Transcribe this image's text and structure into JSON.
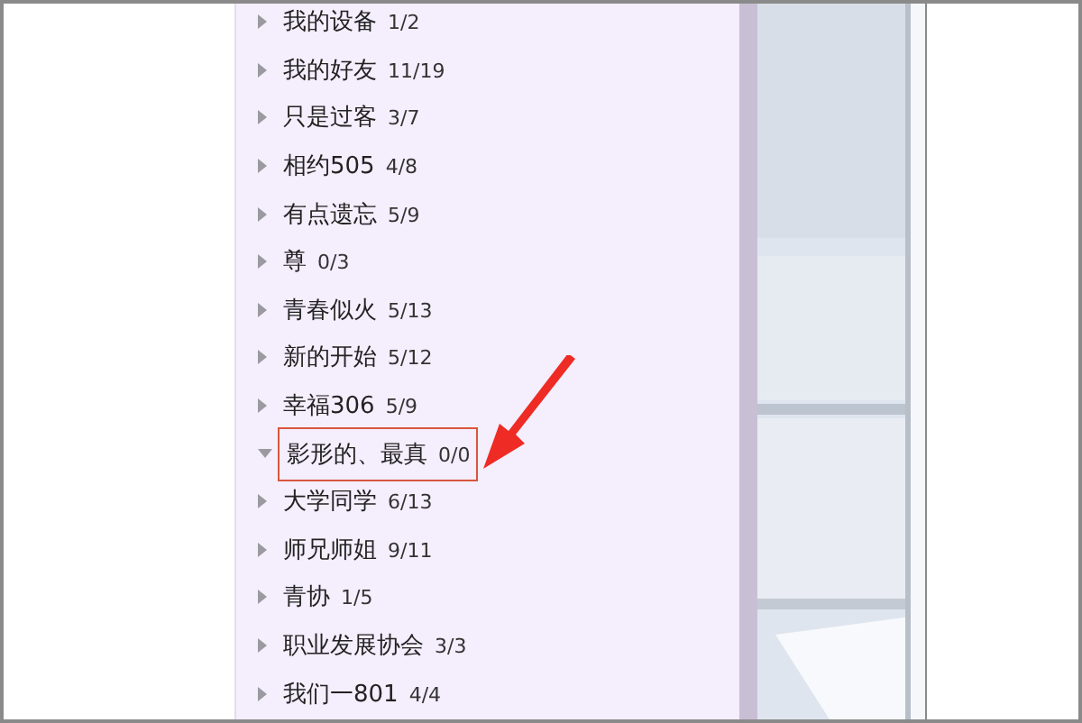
{
  "contact_groups": [
    {
      "name": "我的设备",
      "count": "1/2",
      "expanded": false,
      "highlighted": false
    },
    {
      "name": "我的好友",
      "count": "11/19",
      "expanded": false,
      "highlighted": false
    },
    {
      "name": "只是过客",
      "count": "3/7",
      "expanded": false,
      "highlighted": false
    },
    {
      "name": "相约505",
      "count": "4/8",
      "expanded": false,
      "highlighted": false
    },
    {
      "name": "有点遗忘",
      "count": "5/9",
      "expanded": false,
      "highlighted": false
    },
    {
      "name": "尊",
      "count": "0/3",
      "expanded": false,
      "highlighted": false
    },
    {
      "name": "青春似火",
      "count": "5/13",
      "expanded": false,
      "highlighted": false
    },
    {
      "name": "新的开始",
      "count": "5/12",
      "expanded": false,
      "highlighted": false
    },
    {
      "name": "幸福306",
      "count": "5/9",
      "expanded": false,
      "highlighted": false
    },
    {
      "name": "影形的、最真",
      "count": "0/0",
      "expanded": true,
      "highlighted": true
    },
    {
      "name": "大学同学",
      "count": "6/13",
      "expanded": false,
      "highlighted": false
    },
    {
      "name": "师兄师姐",
      "count": "9/11",
      "expanded": false,
      "highlighted": false
    },
    {
      "name": "青协",
      "count": "1/5",
      "expanded": false,
      "highlighted": false
    },
    {
      "name": "职业发展协会",
      "count": "3/3",
      "expanded": false,
      "highlighted": false
    },
    {
      "name": "我们一801",
      "count": "4/4",
      "expanded": false,
      "highlighted": false
    }
  ]
}
